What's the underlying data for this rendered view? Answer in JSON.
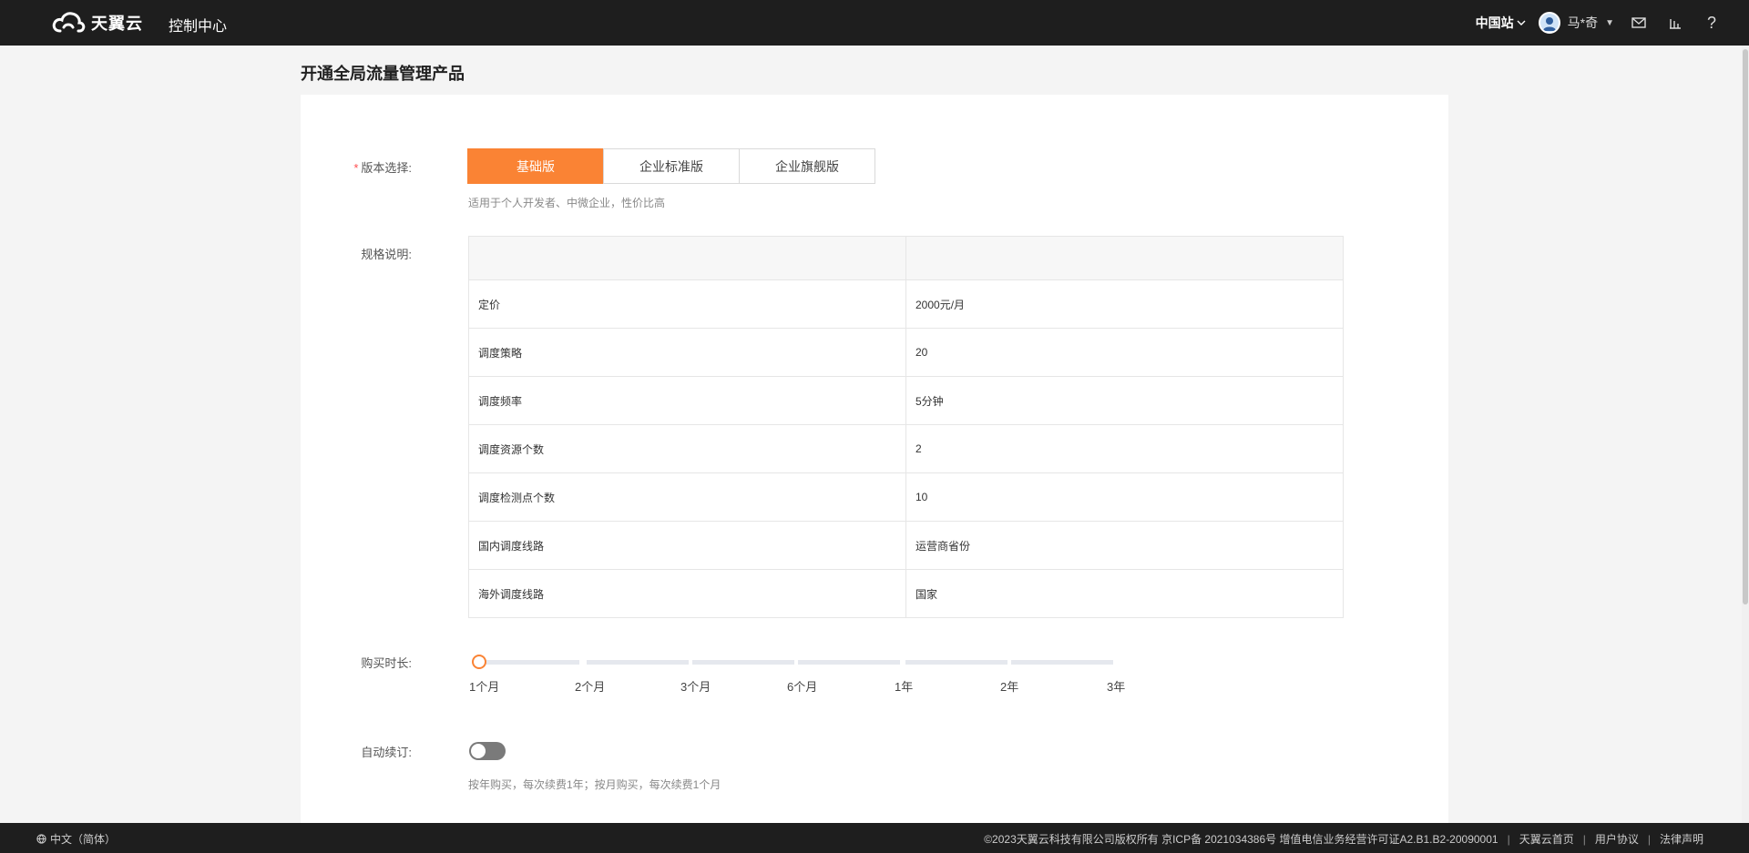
{
  "header": {
    "logo_text": "天翼云",
    "console": "控制中心",
    "region": "中国站",
    "username": "马*奇"
  },
  "page": {
    "title": "开通全局流量管理产品"
  },
  "form": {
    "version_label": "版本选择:",
    "versions": [
      "基础版",
      "企业标准版",
      "企业旗舰版"
    ],
    "selected_version": "基础版",
    "version_hint": "适用于个人开发者、中微企业，性价比高",
    "spec_label": "规格说明:",
    "spec_rows": [
      {
        "name": "定价",
        "value": "2000元/月"
      },
      {
        "name": "调度策略",
        "value": "20"
      },
      {
        "name": "调度频率",
        "value": "5分钟"
      },
      {
        "name": "调度资源个数",
        "value": "2"
      },
      {
        "name": "调度检测点个数",
        "value": "10"
      },
      {
        "name": "国内调度线路",
        "value": "运营商省份"
      },
      {
        "name": "海外调度线路",
        "value": "国家"
      }
    ],
    "duration_label": "购买时长:",
    "duration_options": [
      "1个月",
      "2个月",
      "3个月",
      "6个月",
      "1年",
      "2年",
      "3年"
    ],
    "selected_duration": "1个月",
    "auto_renew_label": "自动续订:",
    "auto_renew_on": false,
    "auto_renew_hint": "按年购买，每次续费1年；按月购买，每次续费1个月"
  },
  "footer": {
    "language": "中文（简体）",
    "copyright": "©2023天翼云科技有限公司版权所有 京ICP备 2021034386号 增值电信业务经营许可证A2.B1.B2-20090001",
    "links": [
      "天翼云首页",
      "用户协议",
      "法律声明"
    ]
  },
  "colors": {
    "accent": "#fa8334",
    "topbar": "#1e1e1e"
  }
}
